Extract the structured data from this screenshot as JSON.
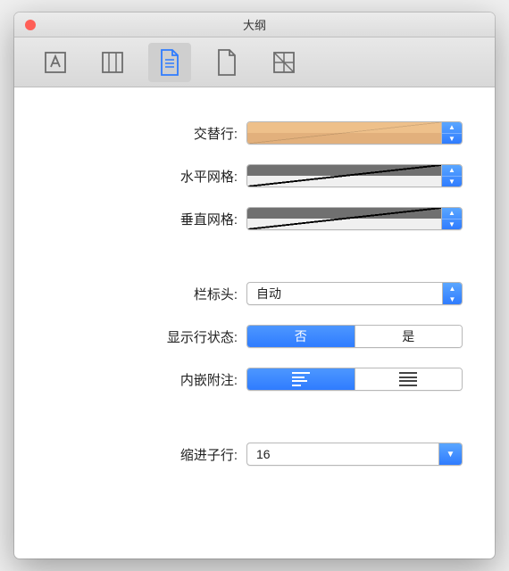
{
  "window": {
    "title": "大纲"
  },
  "toolbar": {
    "tabs": [
      "text",
      "columns",
      "document",
      "page",
      "diagonal"
    ],
    "active_index": 2
  },
  "form": {
    "alternating_rows": {
      "label": "交替行:"
    },
    "horizontal_grid": {
      "label": "水平网格:"
    },
    "vertical_grid": {
      "label": "垂直网格:"
    },
    "column_header": {
      "label": "栏标头:",
      "value": "自动"
    },
    "show_row_status": {
      "label": "显示行状态:",
      "option_no": "否",
      "option_yes": "是",
      "selected": "no"
    },
    "inline_notes": {
      "label": "内嵌附注:"
    },
    "indent_child": {
      "label": "缩进子行:",
      "value": "16"
    }
  }
}
